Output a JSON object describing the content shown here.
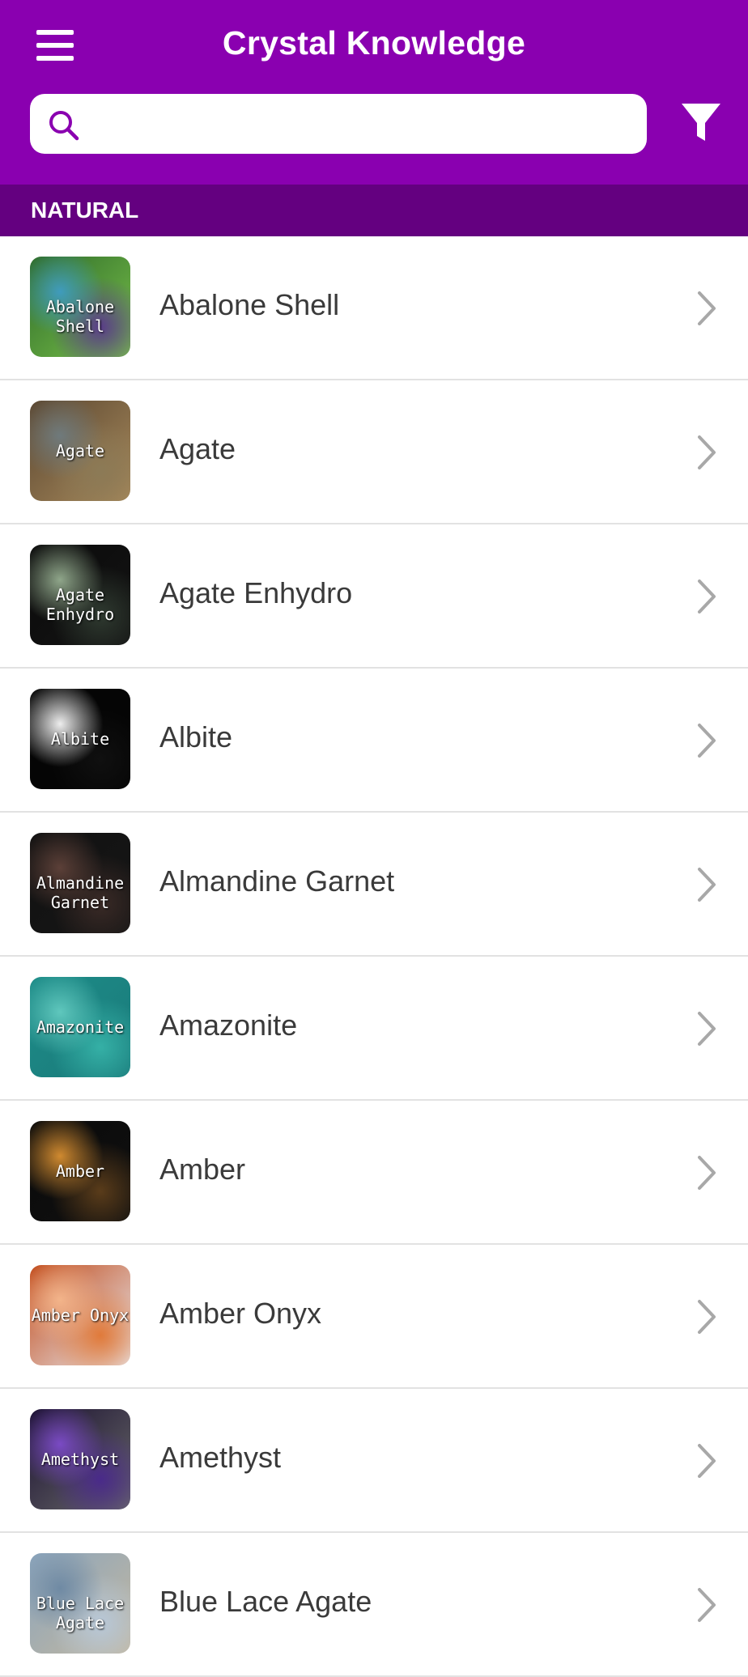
{
  "app": {
    "title": "Crystal Knowledge"
  },
  "search": {
    "placeholder": "",
    "value": ""
  },
  "colors": {
    "header": "#8a00b0",
    "section": "#640080",
    "accent": "#ffffff"
  },
  "section": {
    "label": "NATURAL"
  },
  "items": [
    {
      "name": "Abalone Shell",
      "thumb_text": "Abalone Shell",
      "thumb_colors": [
        "#2e6b2a",
        "#5a3c8a",
        "#3f9bbd",
        "#7ac24a"
      ]
    },
    {
      "name": "Agate",
      "thumb_text": "Agate",
      "thumb_colors": [
        "#5a4630",
        "#8c7a56",
        "#6f7a7c",
        "#a88a5c"
      ]
    },
    {
      "name": "Agate Enhydro",
      "thumb_text": "Agate Enhydro",
      "thumb_colors": [
        "#0a0a0a",
        "#2f3a30",
        "#8fa68a",
        "#141414"
      ]
    },
    {
      "name": "Albite",
      "thumb_text": "Albite",
      "thumb_colors": [
        "#050505",
        "#101010",
        "#eeeeee",
        "#050505"
      ]
    },
    {
      "name": "Almandine Garnet",
      "thumb_text": "Almandine Garnet",
      "thumb_colors": [
        "#111111",
        "#3a2a26",
        "#5c4038",
        "#161616"
      ]
    },
    {
      "name": "Amazonite",
      "thumb_text": "Amazonite",
      "thumb_colors": [
        "#1d8c88",
        "#35b0a6",
        "#5fc7bd",
        "#1a7a7a"
      ]
    },
    {
      "name": "Amber",
      "thumb_text": "Amber",
      "thumb_colors": [
        "#0a0a0a",
        "#5a3c1a",
        "#d08a30",
        "#101010"
      ]
    },
    {
      "name": "Amber Onyx",
      "thumb_text": "Amber Onyx",
      "thumb_colors": [
        "#c04a1a",
        "#e07a3a",
        "#f3b48a",
        "#e9e9ee"
      ]
    },
    {
      "name": "Amethyst",
      "thumb_text": "Amethyst",
      "thumb_colors": [
        "#1a1030",
        "#4a2a8a",
        "#7a4ac4",
        "#6a6a6a"
      ]
    },
    {
      "name": "Blue Lace Agate",
      "thumb_text": "Blue Lace Agate",
      "thumb_colors": [
        "#8aa4bc",
        "#b8c8d8",
        "#6f8aa4",
        "#c4b8a0"
      ]
    }
  ]
}
